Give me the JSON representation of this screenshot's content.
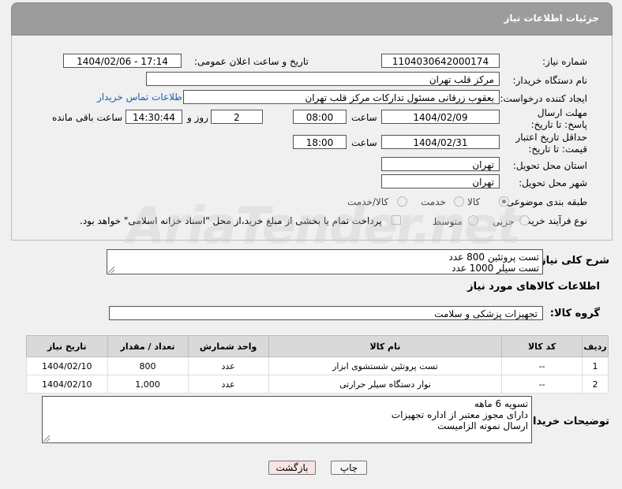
{
  "header": {
    "title": "جزئیات اطلاعات نیاز"
  },
  "form": {
    "need_number_label": "شماره نیاز:",
    "need_number": "1104030642000174",
    "announce_label": "تاریخ و ساعت اعلان عمومی:",
    "announce_value": "1404/02/06 - 17:14",
    "buyer_org_label": "نام دستگاه خریدار:",
    "buyer_org": "مرکز قلب تهران",
    "creator_label": "ایجاد کننده درخواست:",
    "creator": "یعقوب زرقانی مسئول تدارکات مرکز قلب تهران",
    "contact_link": "اطلاعات تماس خریدار",
    "reply_deadline_label": "مهلت ارسال پاسخ: تا تاریخ:",
    "reply_date": "1404/02/09",
    "time_label": "ساعت",
    "reply_time": "08:00",
    "days_value": "2",
    "days_and_label": "روز و",
    "remaining_time": "14:30:44",
    "remaining_label": "ساعت باقی مانده",
    "price_validity_label": "حداقل تاریخ اعتبار قیمت: تا تاریخ:",
    "price_date": "1404/02/31",
    "time_label2": "ساعت",
    "price_time": "18:00",
    "province_label": "استان محل تحویل:",
    "province": "تهران",
    "city_label": "شهر محل تحویل:",
    "city": "تهران",
    "category_label": "طبقه بندی موضوعی:",
    "category_options": [
      "کالا",
      "خدمت",
      "کالا/خدمت"
    ],
    "process_label": "نوع فرآیند خرید :",
    "process_options": [
      "جزیی",
      "متوسط"
    ],
    "payment_note": "پرداخت تمام یا بخشی از مبلغ خرید،از محل \"اسناد خزانه اسلامی\" خواهد بود."
  },
  "description": {
    "label": "شرح کلی نیاز:",
    "lines": [
      "تست پروتئین 800 عدد",
      "تست سیلر  1000 عدد"
    ]
  },
  "goods_section": {
    "title": "اطلاعات کالاهای مورد نیاز",
    "group_label": "گروه کالا:",
    "group_value": "تجهیزات پزشکی و سلامت"
  },
  "table": {
    "headers": [
      "ردیف",
      "کد کالا",
      "نام کالا",
      "واحد شمارش",
      "تعداد / مقدار",
      "تاریخ نیاز"
    ],
    "rows": [
      [
        "1",
        "--",
        "تست پروتئین شستشوی ابزار",
        "عدد",
        "800",
        "1404/02/10"
      ],
      [
        "2",
        "--",
        "نوار دستگاه سیلر حرارتی",
        "عدد",
        "1,000",
        "1404/02/10"
      ]
    ]
  },
  "buyer_notes": {
    "label": "توضیحات خریدار:",
    "lines": [
      "تسویه 6 ماهه",
      "دارای مجوز معتبر از اداره تجهیزات",
      "ارسال نمونه الزامیست"
    ]
  },
  "buttons": {
    "print": "چاپ",
    "back": "بازگشت"
  }
}
